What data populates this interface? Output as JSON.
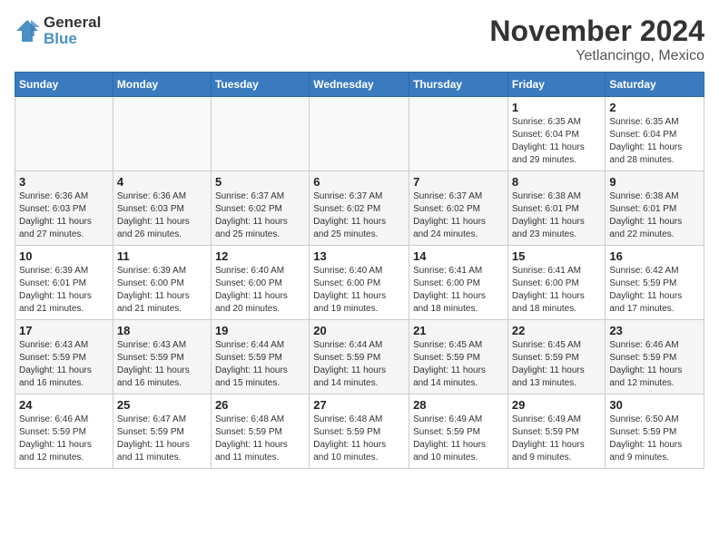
{
  "header": {
    "logo_general": "General",
    "logo_blue": "Blue",
    "month_year": "November 2024",
    "location": "Yetlancingo, Mexico"
  },
  "weekdays": [
    "Sunday",
    "Monday",
    "Tuesday",
    "Wednesday",
    "Thursday",
    "Friday",
    "Saturday"
  ],
  "weeks": [
    [
      {
        "day": "",
        "info": ""
      },
      {
        "day": "",
        "info": ""
      },
      {
        "day": "",
        "info": ""
      },
      {
        "day": "",
        "info": ""
      },
      {
        "day": "",
        "info": ""
      },
      {
        "day": "1",
        "info": "Sunrise: 6:35 AM\nSunset: 6:04 PM\nDaylight: 11 hours\nand 29 minutes."
      },
      {
        "day": "2",
        "info": "Sunrise: 6:35 AM\nSunset: 6:04 PM\nDaylight: 11 hours\nand 28 minutes."
      }
    ],
    [
      {
        "day": "3",
        "info": "Sunrise: 6:36 AM\nSunset: 6:03 PM\nDaylight: 11 hours\nand 27 minutes."
      },
      {
        "day": "4",
        "info": "Sunrise: 6:36 AM\nSunset: 6:03 PM\nDaylight: 11 hours\nand 26 minutes."
      },
      {
        "day": "5",
        "info": "Sunrise: 6:37 AM\nSunset: 6:02 PM\nDaylight: 11 hours\nand 25 minutes."
      },
      {
        "day": "6",
        "info": "Sunrise: 6:37 AM\nSunset: 6:02 PM\nDaylight: 11 hours\nand 25 minutes."
      },
      {
        "day": "7",
        "info": "Sunrise: 6:37 AM\nSunset: 6:02 PM\nDaylight: 11 hours\nand 24 minutes."
      },
      {
        "day": "8",
        "info": "Sunrise: 6:38 AM\nSunset: 6:01 PM\nDaylight: 11 hours\nand 23 minutes."
      },
      {
        "day": "9",
        "info": "Sunrise: 6:38 AM\nSunset: 6:01 PM\nDaylight: 11 hours\nand 22 minutes."
      }
    ],
    [
      {
        "day": "10",
        "info": "Sunrise: 6:39 AM\nSunset: 6:01 PM\nDaylight: 11 hours\nand 21 minutes."
      },
      {
        "day": "11",
        "info": "Sunrise: 6:39 AM\nSunset: 6:00 PM\nDaylight: 11 hours\nand 21 minutes."
      },
      {
        "day": "12",
        "info": "Sunrise: 6:40 AM\nSunset: 6:00 PM\nDaylight: 11 hours\nand 20 minutes."
      },
      {
        "day": "13",
        "info": "Sunrise: 6:40 AM\nSunset: 6:00 PM\nDaylight: 11 hours\nand 19 minutes."
      },
      {
        "day": "14",
        "info": "Sunrise: 6:41 AM\nSunset: 6:00 PM\nDaylight: 11 hours\nand 18 minutes."
      },
      {
        "day": "15",
        "info": "Sunrise: 6:41 AM\nSunset: 6:00 PM\nDaylight: 11 hours\nand 18 minutes."
      },
      {
        "day": "16",
        "info": "Sunrise: 6:42 AM\nSunset: 5:59 PM\nDaylight: 11 hours\nand 17 minutes."
      }
    ],
    [
      {
        "day": "17",
        "info": "Sunrise: 6:43 AM\nSunset: 5:59 PM\nDaylight: 11 hours\nand 16 minutes."
      },
      {
        "day": "18",
        "info": "Sunrise: 6:43 AM\nSunset: 5:59 PM\nDaylight: 11 hours\nand 16 minutes."
      },
      {
        "day": "19",
        "info": "Sunrise: 6:44 AM\nSunset: 5:59 PM\nDaylight: 11 hours\nand 15 minutes."
      },
      {
        "day": "20",
        "info": "Sunrise: 6:44 AM\nSunset: 5:59 PM\nDaylight: 11 hours\nand 14 minutes."
      },
      {
        "day": "21",
        "info": "Sunrise: 6:45 AM\nSunset: 5:59 PM\nDaylight: 11 hours\nand 14 minutes."
      },
      {
        "day": "22",
        "info": "Sunrise: 6:45 AM\nSunset: 5:59 PM\nDaylight: 11 hours\nand 13 minutes."
      },
      {
        "day": "23",
        "info": "Sunrise: 6:46 AM\nSunset: 5:59 PM\nDaylight: 11 hours\nand 12 minutes."
      }
    ],
    [
      {
        "day": "24",
        "info": "Sunrise: 6:46 AM\nSunset: 5:59 PM\nDaylight: 11 hours\nand 12 minutes."
      },
      {
        "day": "25",
        "info": "Sunrise: 6:47 AM\nSunset: 5:59 PM\nDaylight: 11 hours\nand 11 minutes."
      },
      {
        "day": "26",
        "info": "Sunrise: 6:48 AM\nSunset: 5:59 PM\nDaylight: 11 hours\nand 11 minutes."
      },
      {
        "day": "27",
        "info": "Sunrise: 6:48 AM\nSunset: 5:59 PM\nDaylight: 11 hours\nand 10 minutes."
      },
      {
        "day": "28",
        "info": "Sunrise: 6:49 AM\nSunset: 5:59 PM\nDaylight: 11 hours\nand 10 minutes."
      },
      {
        "day": "29",
        "info": "Sunrise: 6:49 AM\nSunset: 5:59 PM\nDaylight: 11 hours\nand 9 minutes."
      },
      {
        "day": "30",
        "info": "Sunrise: 6:50 AM\nSunset: 5:59 PM\nDaylight: 11 hours\nand 9 minutes."
      }
    ]
  ]
}
